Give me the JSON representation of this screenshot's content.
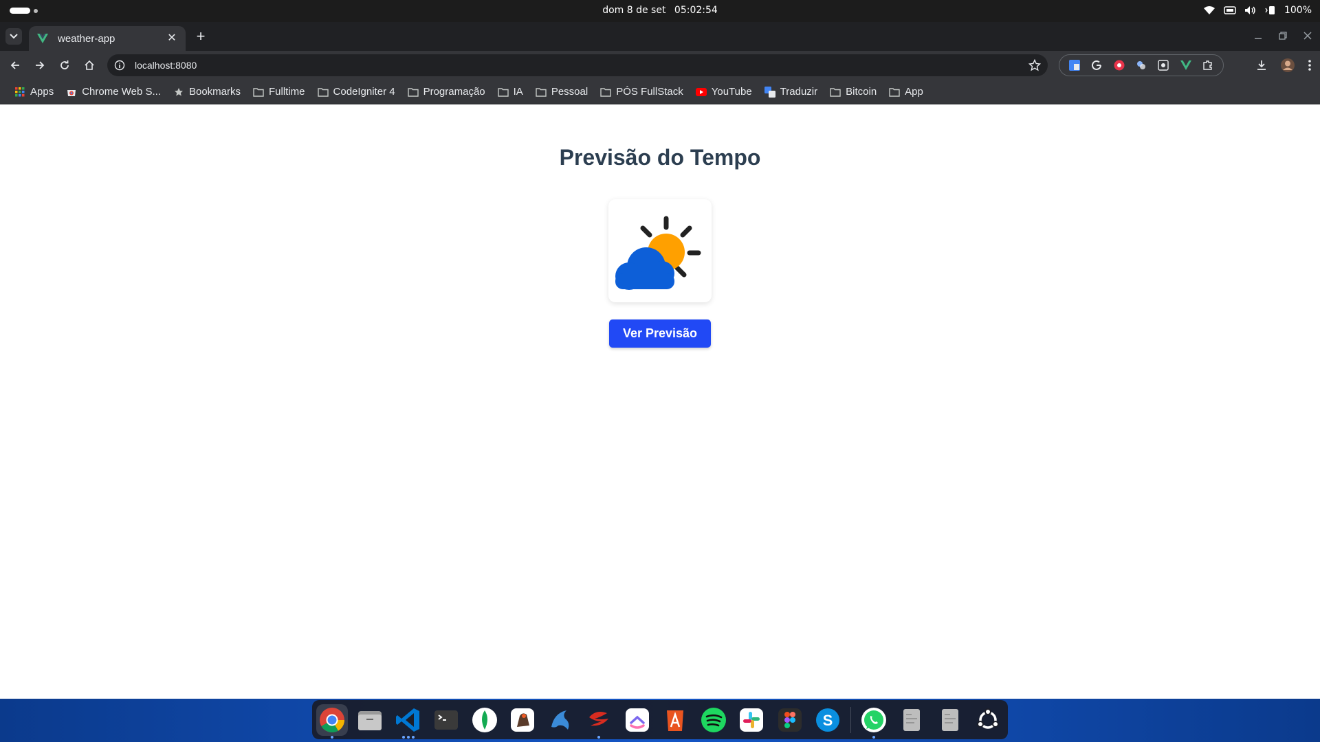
{
  "system_bar": {
    "date": "dom 8 de set",
    "time": "05:02:54",
    "battery": "100%"
  },
  "browser": {
    "tab_title": "weather-app",
    "url": "localhost:8080",
    "bookmarks": [
      {
        "label": "Apps",
        "icon": "apps-grid-icon"
      },
      {
        "label": "Chrome Web S...",
        "icon": "chrome-web-store-icon"
      },
      {
        "label": "Bookmarks",
        "icon": "star-icon"
      },
      {
        "label": "Fulltime",
        "icon": "folder-icon"
      },
      {
        "label": "CodeIgniter 4",
        "icon": "folder-icon"
      },
      {
        "label": "Programação",
        "icon": "folder-icon"
      },
      {
        "label": "IA",
        "icon": "folder-icon"
      },
      {
        "label": "Pessoal",
        "icon": "folder-icon"
      },
      {
        "label": "PÓS FullStack",
        "icon": "folder-icon"
      },
      {
        "label": "YouTube",
        "icon": "youtube-icon"
      },
      {
        "label": "Traduzir",
        "icon": "translate-icon"
      },
      {
        "label": "Bitcoin",
        "icon": "folder-icon"
      },
      {
        "label": "App",
        "icon": "folder-icon"
      }
    ]
  },
  "page": {
    "title": "Previsão do Tempo",
    "weather_icon": "partly-cloudy-icon",
    "button_label": "Ver Previsão"
  },
  "colors": {
    "title": "#2c3e50",
    "button": "#2149f5",
    "sun": "#ffa000",
    "cloud": "#0d5fd8"
  },
  "dock_apps": [
    "Chrome",
    "Files",
    "VS Code",
    "Terminal",
    "MongoDB Compass",
    "Postman",
    "MySQL Workbench",
    "Redis",
    "ClickUp",
    "App Center",
    "Spotify",
    "Slack",
    "Figma",
    "Skype",
    "WhatsApp",
    "Document",
    "Document",
    "Ubuntu"
  ]
}
